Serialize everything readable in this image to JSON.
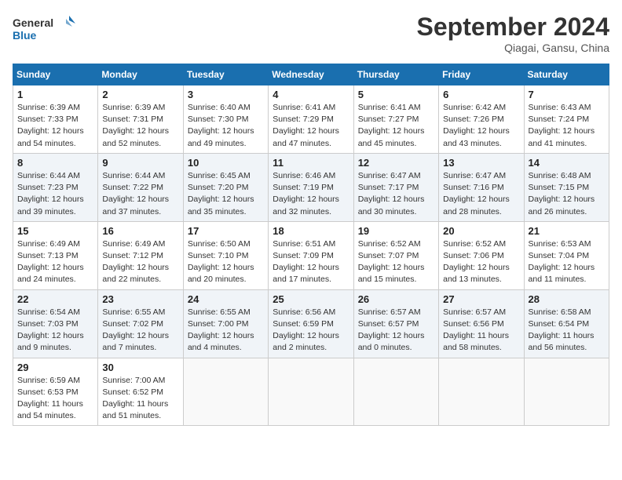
{
  "header": {
    "logo_line1": "General",
    "logo_line2": "Blue",
    "month": "September 2024",
    "location": "Qiagai, Gansu, China"
  },
  "weekdays": [
    "Sunday",
    "Monday",
    "Tuesday",
    "Wednesday",
    "Thursday",
    "Friday",
    "Saturday"
  ],
  "weeks": [
    [
      {
        "day": "1",
        "info": "Sunrise: 6:39 AM\nSunset: 7:33 PM\nDaylight: 12 hours\nand 54 minutes."
      },
      {
        "day": "2",
        "info": "Sunrise: 6:39 AM\nSunset: 7:31 PM\nDaylight: 12 hours\nand 52 minutes."
      },
      {
        "day": "3",
        "info": "Sunrise: 6:40 AM\nSunset: 7:30 PM\nDaylight: 12 hours\nand 49 minutes."
      },
      {
        "day": "4",
        "info": "Sunrise: 6:41 AM\nSunset: 7:29 PM\nDaylight: 12 hours\nand 47 minutes."
      },
      {
        "day": "5",
        "info": "Sunrise: 6:41 AM\nSunset: 7:27 PM\nDaylight: 12 hours\nand 45 minutes."
      },
      {
        "day": "6",
        "info": "Sunrise: 6:42 AM\nSunset: 7:26 PM\nDaylight: 12 hours\nand 43 minutes."
      },
      {
        "day": "7",
        "info": "Sunrise: 6:43 AM\nSunset: 7:24 PM\nDaylight: 12 hours\nand 41 minutes."
      }
    ],
    [
      {
        "day": "8",
        "info": "Sunrise: 6:44 AM\nSunset: 7:23 PM\nDaylight: 12 hours\nand 39 minutes."
      },
      {
        "day": "9",
        "info": "Sunrise: 6:44 AM\nSunset: 7:22 PM\nDaylight: 12 hours\nand 37 minutes."
      },
      {
        "day": "10",
        "info": "Sunrise: 6:45 AM\nSunset: 7:20 PM\nDaylight: 12 hours\nand 35 minutes."
      },
      {
        "day": "11",
        "info": "Sunrise: 6:46 AM\nSunset: 7:19 PM\nDaylight: 12 hours\nand 32 minutes."
      },
      {
        "day": "12",
        "info": "Sunrise: 6:47 AM\nSunset: 7:17 PM\nDaylight: 12 hours\nand 30 minutes."
      },
      {
        "day": "13",
        "info": "Sunrise: 6:47 AM\nSunset: 7:16 PM\nDaylight: 12 hours\nand 28 minutes."
      },
      {
        "day": "14",
        "info": "Sunrise: 6:48 AM\nSunset: 7:15 PM\nDaylight: 12 hours\nand 26 minutes."
      }
    ],
    [
      {
        "day": "15",
        "info": "Sunrise: 6:49 AM\nSunset: 7:13 PM\nDaylight: 12 hours\nand 24 minutes."
      },
      {
        "day": "16",
        "info": "Sunrise: 6:49 AM\nSunset: 7:12 PM\nDaylight: 12 hours\nand 22 minutes."
      },
      {
        "day": "17",
        "info": "Sunrise: 6:50 AM\nSunset: 7:10 PM\nDaylight: 12 hours\nand 20 minutes."
      },
      {
        "day": "18",
        "info": "Sunrise: 6:51 AM\nSunset: 7:09 PM\nDaylight: 12 hours\nand 17 minutes."
      },
      {
        "day": "19",
        "info": "Sunrise: 6:52 AM\nSunset: 7:07 PM\nDaylight: 12 hours\nand 15 minutes."
      },
      {
        "day": "20",
        "info": "Sunrise: 6:52 AM\nSunset: 7:06 PM\nDaylight: 12 hours\nand 13 minutes."
      },
      {
        "day": "21",
        "info": "Sunrise: 6:53 AM\nSunset: 7:04 PM\nDaylight: 12 hours\nand 11 minutes."
      }
    ],
    [
      {
        "day": "22",
        "info": "Sunrise: 6:54 AM\nSunset: 7:03 PM\nDaylight: 12 hours\nand 9 minutes."
      },
      {
        "day": "23",
        "info": "Sunrise: 6:55 AM\nSunset: 7:02 PM\nDaylight: 12 hours\nand 7 minutes."
      },
      {
        "day": "24",
        "info": "Sunrise: 6:55 AM\nSunset: 7:00 PM\nDaylight: 12 hours\nand 4 minutes."
      },
      {
        "day": "25",
        "info": "Sunrise: 6:56 AM\nSunset: 6:59 PM\nDaylight: 12 hours\nand 2 minutes."
      },
      {
        "day": "26",
        "info": "Sunrise: 6:57 AM\nSunset: 6:57 PM\nDaylight: 12 hours\nand 0 minutes."
      },
      {
        "day": "27",
        "info": "Sunrise: 6:57 AM\nSunset: 6:56 PM\nDaylight: 11 hours\nand 58 minutes."
      },
      {
        "day": "28",
        "info": "Sunrise: 6:58 AM\nSunset: 6:54 PM\nDaylight: 11 hours\nand 56 minutes."
      }
    ],
    [
      {
        "day": "29",
        "info": "Sunrise: 6:59 AM\nSunset: 6:53 PM\nDaylight: 11 hours\nand 54 minutes."
      },
      {
        "day": "30",
        "info": "Sunrise: 7:00 AM\nSunset: 6:52 PM\nDaylight: 11 hours\nand 51 minutes."
      },
      {
        "day": "",
        "info": ""
      },
      {
        "day": "",
        "info": ""
      },
      {
        "day": "",
        "info": ""
      },
      {
        "day": "",
        "info": ""
      },
      {
        "day": "",
        "info": ""
      }
    ]
  ]
}
